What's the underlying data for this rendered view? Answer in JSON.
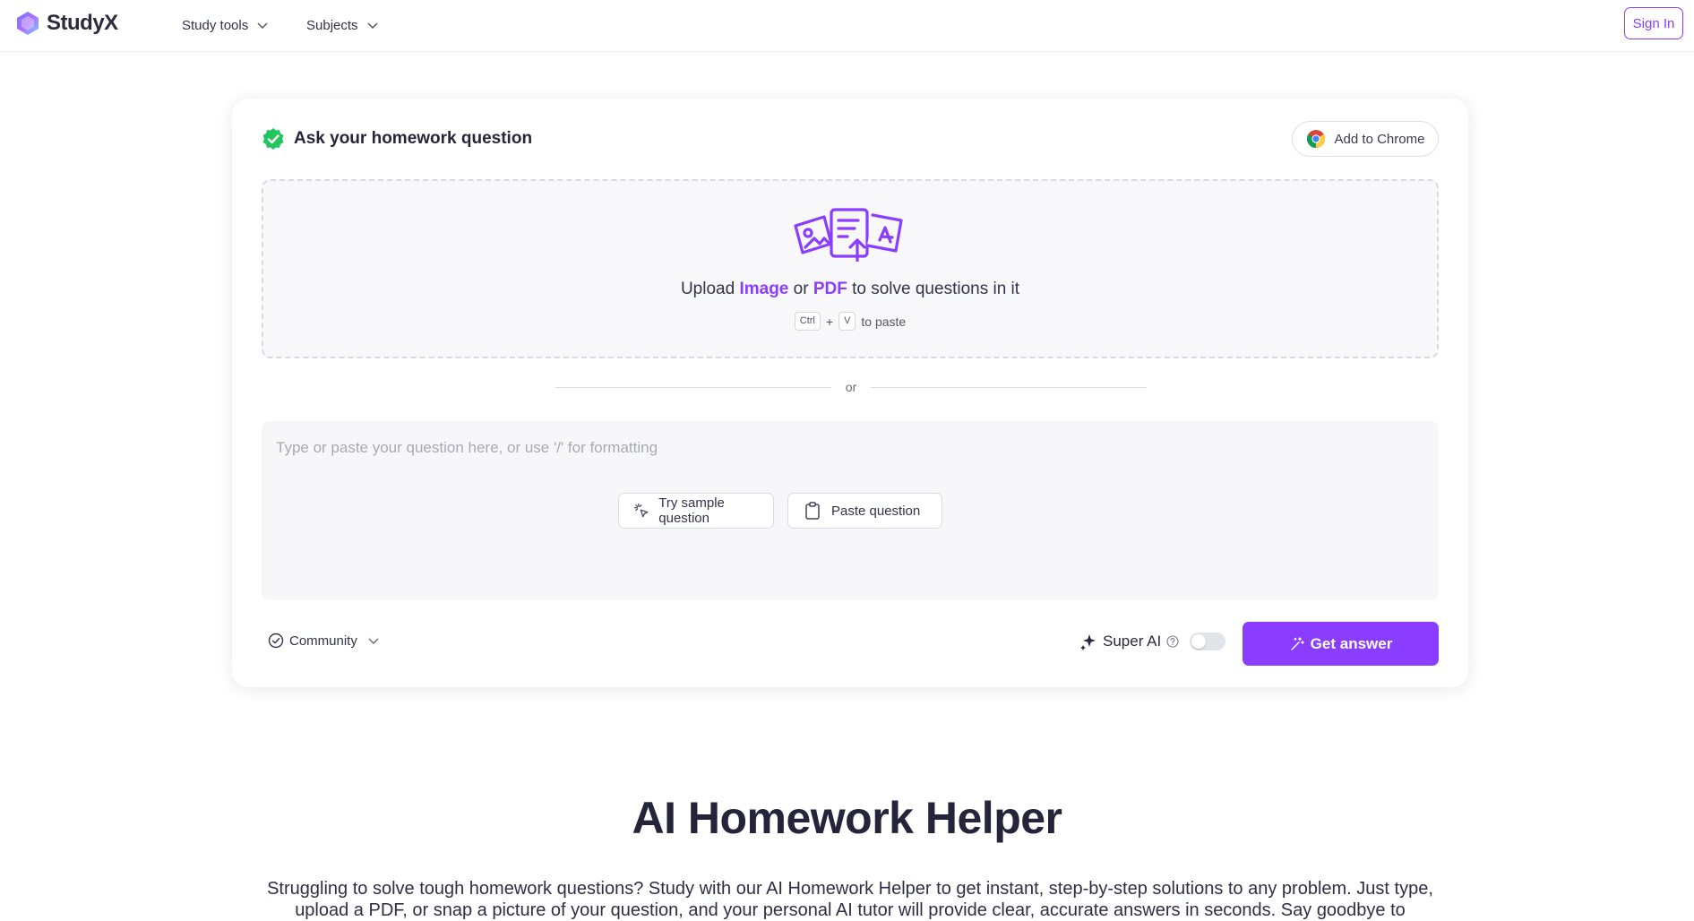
{
  "header": {
    "logo_text": "StudyX",
    "nav": [
      {
        "label": "Study tools"
      },
      {
        "label": "Subjects"
      }
    ],
    "sign_in_label": "Sign In"
  },
  "card": {
    "title": "Ask your homework question",
    "chrome_button_label": "Add to Chrome",
    "upload": {
      "prefix": "Upload ",
      "image_word": "Image",
      "middle": " or ",
      "pdf_word": "PDF",
      "suffix": " to solve questions in it",
      "key_ctrl": "Ctrl",
      "plus": "+",
      "key_v": "V",
      "paste_hint": "to paste"
    },
    "or_label": "or",
    "question": {
      "placeholder": "Type or paste your question here, or use '/' for formatting",
      "value": "",
      "sample_button_label": "Try sample question",
      "paste_button_label": "Paste question"
    },
    "community_label": "Community",
    "super_ai_label": "Super AI",
    "super_ai_enabled": false,
    "get_answer_label": "Get answer"
  },
  "hero": {
    "title": "AI Homework Helper",
    "description": "Struggling to solve tough homework questions? Study with our AI Homework Helper to get instant, step-by-step solutions to any problem. Just type, upload a PDF, or snap a picture of your question, and your personal AI tutor will provide clear, accurate answers in seconds. Say goodbye to"
  },
  "colors": {
    "accent": "#8b3dff",
    "success": "#22c55e",
    "text_primary": "#24243a",
    "border": "#dcdce4"
  },
  "icons": {
    "logo": "studyx-logo-icon",
    "chevron": "chevron-down-icon",
    "check": "check-badge-icon",
    "chrome": "chrome-icon",
    "upload": "upload-files-icon",
    "sample": "sparkle-cursor-icon",
    "paste": "clipboard-icon",
    "community": "check-circle-icon",
    "super_ai": "sparkle-icon",
    "help": "help-circle-icon",
    "magic": "magic-wand-icon"
  }
}
